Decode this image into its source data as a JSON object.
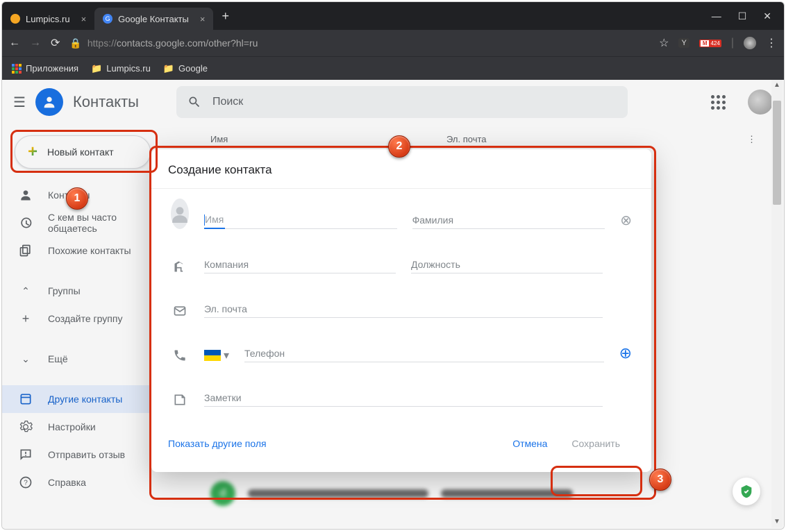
{
  "browser": {
    "tabs": [
      {
        "title": "Lumpics.ru"
      },
      {
        "title": "Google Контакты"
      }
    ],
    "url_proto": "https://",
    "url_rest": "contacts.google.com/other?hl=ru",
    "gmail_badge": "424",
    "bookmarks": {
      "apps": "Приложения",
      "lumpics": "Lumpics.ru",
      "google": "Google"
    }
  },
  "app": {
    "title": "Контакты",
    "search_placeholder": "Поиск"
  },
  "sidebar": {
    "new_contact": "Новый контакт",
    "contacts": "Контакты",
    "frequent": "С кем вы часто общаетесь",
    "similar": "Похожие контакты",
    "groups": "Группы",
    "create_group": "Создайте группу",
    "more": "Ещё",
    "other_contacts": "Другие контакты",
    "settings": "Настройки",
    "feedback": "Отправить отзыв",
    "help": "Справка"
  },
  "columns": {
    "name": "Имя",
    "email": "Эл. почта"
  },
  "modal": {
    "title": "Создание контакта",
    "first_name": "Имя",
    "last_name": "Фамилия",
    "company": "Компания",
    "job": "Должность",
    "email": "Эл. почта",
    "phone": "Телефон",
    "notes": "Заметки",
    "more_fields": "Показать другие поля",
    "cancel": "Отмена",
    "save": "Сохранить"
  },
  "callouts": {
    "c1": "1",
    "c2": "2",
    "c3": "3"
  }
}
